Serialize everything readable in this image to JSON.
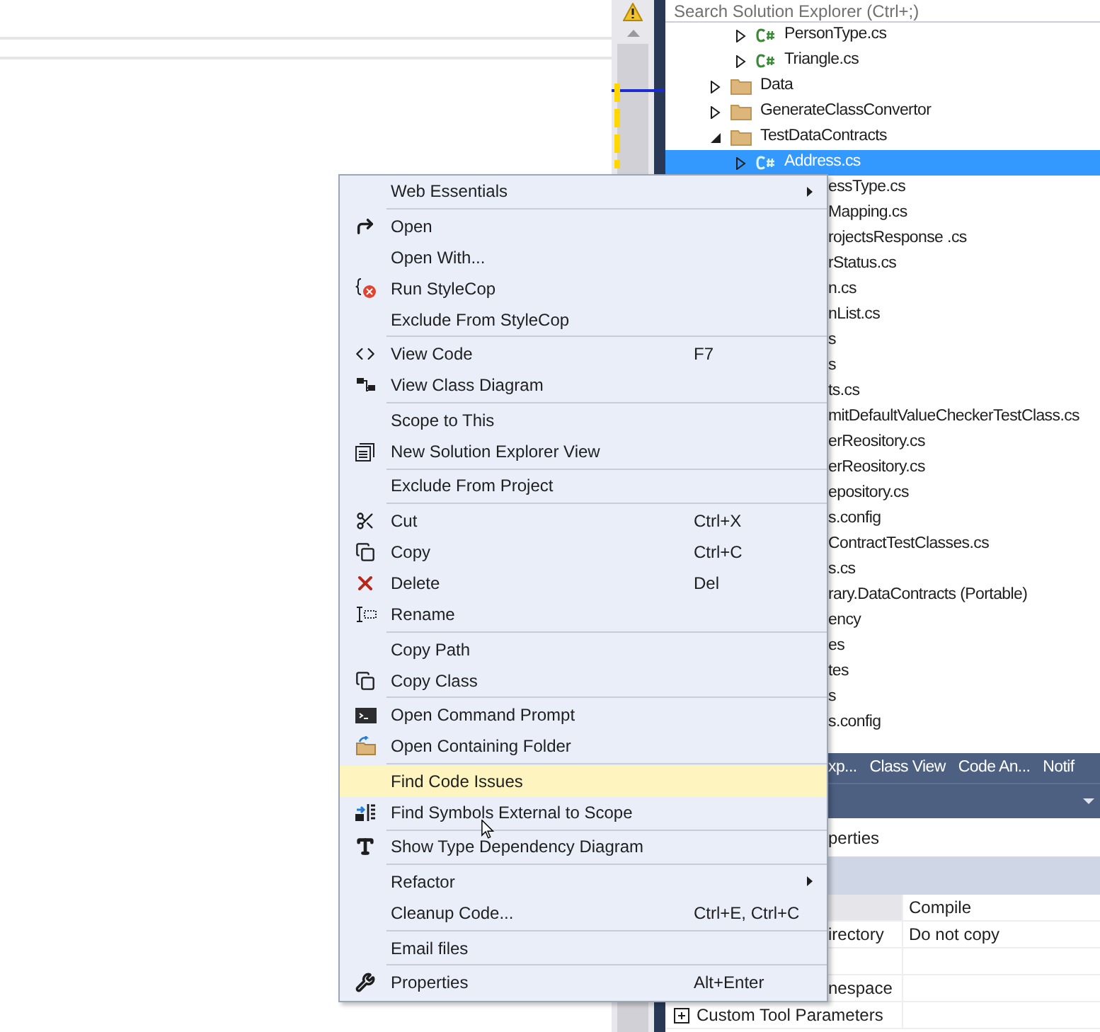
{
  "solution_explorer": {
    "search": {
      "placeholder": "Search Solution Explorer (Ctrl+;)"
    },
    "tree": [
      {
        "children": [
          {
            "label": "PersonType.cs",
            "kind": "cs",
            "expanded": false,
            "selected": false
          },
          {
            "label": "Triangle.cs",
            "kind": "cs",
            "expanded": false,
            "selected": false
          }
        ]
      },
      {
        "label": "Data",
        "kind": "folder",
        "expanded": false,
        "selected": false
      },
      {
        "label": "GenerateClassConvertor",
        "kind": "folder",
        "expanded": false,
        "selected": false
      },
      {
        "label": "TestDataContracts",
        "kind": "folder",
        "expanded": true,
        "selected": false,
        "children": [
          {
            "label": "Address.cs",
            "kind": "cs",
            "expanded": false,
            "selected": true
          },
          {
            "label": "essType.cs",
            "kind": "clipped",
            "selected": false
          },
          {
            "label": "Mapping.cs",
            "kind": "clipped",
            "selected": false
          },
          {
            "label": "rojectsResponse .cs",
            "kind": "clipped",
            "selected": false
          },
          {
            "label": "rStatus.cs",
            "kind": "clipped",
            "selected": false
          },
          {
            "label": "n.cs",
            "kind": "clipped",
            "selected": false
          },
          {
            "label": "nList.cs",
            "kind": "clipped",
            "selected": false
          },
          {
            "label": "s",
            "kind": "clipped",
            "selected": false
          },
          {
            "label": "s",
            "kind": "clipped",
            "selected": false
          },
          {
            "label": "ts.cs",
            "kind": "clipped",
            "selected": false
          },
          {
            "label": "mitDefaultValueCheckerTestClass.cs",
            "kind": "clipped",
            "selected": false
          },
          {
            "label": "erReository.cs",
            "kind": "clipped",
            "selected": false
          },
          {
            "label": "erReository.cs",
            "kind": "clipped",
            "selected": false
          },
          {
            "label": "epository.cs",
            "kind": "clipped",
            "selected": false
          },
          {
            "label": "s.config",
            "kind": "clipped",
            "selected": false
          },
          {
            "label": "ContractTestClasses.cs",
            "kind": "clipped",
            "selected": false
          },
          {
            "label": "s.cs",
            "kind": "clipped",
            "selected": false
          },
          {
            "label": "rary.DataContracts (Portable)",
            "kind": "clipped",
            "selected": false
          },
          {
            "label": "ency",
            "kind": "clipped",
            "selected": false
          },
          {
            "label": "es",
            "kind": "clipped",
            "selected": false
          },
          {
            "label": "tes",
            "kind": "clipped",
            "selected": false
          },
          {
            "label": "s",
            "kind": "clipped",
            "selected": false
          },
          {
            "label": "s.config",
            "kind": "clipped",
            "selected": false
          }
        ]
      }
    ]
  },
  "tool_tabs": [
    "xp...",
    "Class View",
    "Code An...",
    "Notif"
  ],
  "properties": {
    "subject": "perties",
    "rows": [
      {
        "value": "Compile",
        "kind": "clipped",
        "selected": true
      },
      {
        "name": "irectory",
        "value": "Do not copy",
        "kind": "clipped",
        "selected": false
      },
      {
        "kind": "clipped",
        "selected": false
      },
      {
        "name": "nespace",
        "kind": "clipped",
        "selected": false
      },
      {
        "name": "Custom Tool Parameters",
        "kind": "group",
        "expanded": false,
        "selected": false
      }
    ]
  },
  "context_menu": [
    {
      "kind": "item",
      "label": "Web Essentials",
      "submenu": true,
      "selected": false
    },
    {
      "kind": "separator"
    },
    {
      "kind": "item",
      "label": "Open",
      "selected": false
    },
    {
      "kind": "item",
      "label": "Open With...",
      "selected": false
    },
    {
      "kind": "item",
      "label": "Run StyleCop",
      "selected": false
    },
    {
      "kind": "item",
      "label": "Exclude From StyleCop",
      "selected": false
    },
    {
      "kind": "separator"
    },
    {
      "kind": "item",
      "label": "View Code",
      "shortcut": "F7",
      "selected": false
    },
    {
      "kind": "item",
      "label": "View Class Diagram",
      "selected": false
    },
    {
      "kind": "separator"
    },
    {
      "kind": "item",
      "label": "Scope to This",
      "selected": false
    },
    {
      "kind": "item",
      "label": "New Solution Explorer View",
      "selected": false
    },
    {
      "kind": "separator"
    },
    {
      "kind": "item",
      "label": "Exclude From Project",
      "selected": false
    },
    {
      "kind": "separator"
    },
    {
      "kind": "item",
      "label": "Cut",
      "shortcut": "Ctrl+X",
      "selected": false
    },
    {
      "kind": "item",
      "label": "Copy",
      "shortcut": "Ctrl+C",
      "selected": false
    },
    {
      "kind": "item",
      "label": "Delete",
      "shortcut": "Del",
      "selected": false
    },
    {
      "kind": "item",
      "label": "Rename",
      "selected": false
    },
    {
      "kind": "separator"
    },
    {
      "kind": "item",
      "label": "Copy Path",
      "selected": false
    },
    {
      "kind": "item",
      "label": "Copy Class",
      "selected": false
    },
    {
      "kind": "separator"
    },
    {
      "kind": "item",
      "label": "Open Command Prompt",
      "selected": false
    },
    {
      "kind": "item",
      "label": "Open Containing Folder",
      "selected": false
    },
    {
      "kind": "separator"
    },
    {
      "kind": "item",
      "label": "Find Code Issues",
      "selected": true
    },
    {
      "kind": "item",
      "label": "Find Symbols External to Scope",
      "selected": false
    },
    {
      "kind": "separator"
    },
    {
      "kind": "item",
      "label": "Show Type Dependency Diagram",
      "selected": false
    },
    {
      "kind": "separator"
    },
    {
      "kind": "item",
      "label": "Refactor",
      "submenu": true,
      "selected": false
    },
    {
      "kind": "item",
      "label": "Cleanup Code...",
      "shortcut": "Ctrl+E, Ctrl+C",
      "selected": false
    },
    {
      "kind": "separator"
    },
    {
      "kind": "item",
      "label": "Email files",
      "selected": false
    },
    {
      "kind": "separator"
    },
    {
      "kind": "item",
      "label": "Properties",
      "shortcut": "Alt+Enter",
      "selected": false
    }
  ]
}
